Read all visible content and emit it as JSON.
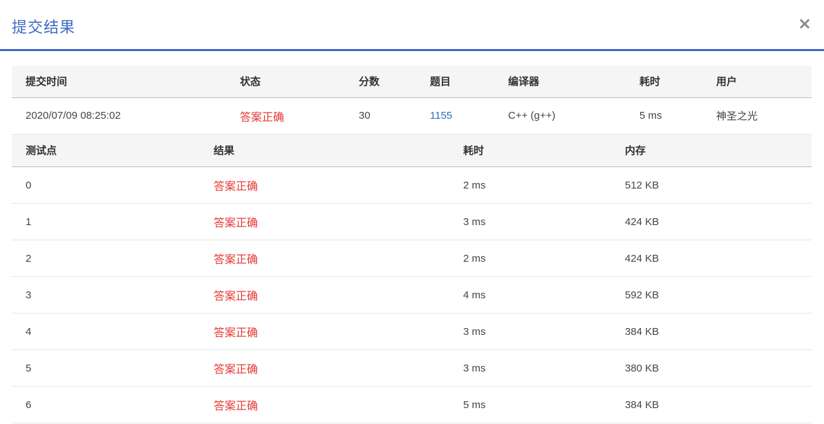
{
  "modal": {
    "title": "提交结果",
    "close_icon": "×"
  },
  "submission": {
    "headers": {
      "time": "提交时间",
      "status": "状态",
      "score": "分数",
      "problem": "题目",
      "compiler": "编译器",
      "duration": "耗时",
      "user": "用户"
    },
    "row": {
      "time": "2020/07/09 08:25:02",
      "status": "答案正确",
      "score": "30",
      "problem": "1155",
      "compiler": "C++ (g++)",
      "duration": "5 ms",
      "user": "神圣之光"
    }
  },
  "testcases": {
    "headers": {
      "case": "测试点",
      "result": "结果",
      "duration": "耗时",
      "memory": "内存"
    },
    "rows": [
      {
        "case": "0",
        "result": "答案正确",
        "duration": "2 ms",
        "memory": "512 KB"
      },
      {
        "case": "1",
        "result": "答案正确",
        "duration": "3 ms",
        "memory": "424 KB"
      },
      {
        "case": "2",
        "result": "答案正确",
        "duration": "2 ms",
        "memory": "424 KB"
      },
      {
        "case": "3",
        "result": "答案正确",
        "duration": "4 ms",
        "memory": "592 KB"
      },
      {
        "case": "4",
        "result": "答案正确",
        "duration": "3 ms",
        "memory": "384 KB"
      },
      {
        "case": "5",
        "result": "答案正确",
        "duration": "3 ms",
        "memory": "380 KB"
      },
      {
        "case": "6",
        "result": "答案正确",
        "duration": "5 ms",
        "memory": "384 KB"
      }
    ]
  },
  "colors": {
    "accent": "#3d6bc2",
    "accepted": "#e53935",
    "link": "#2a6ebb"
  }
}
